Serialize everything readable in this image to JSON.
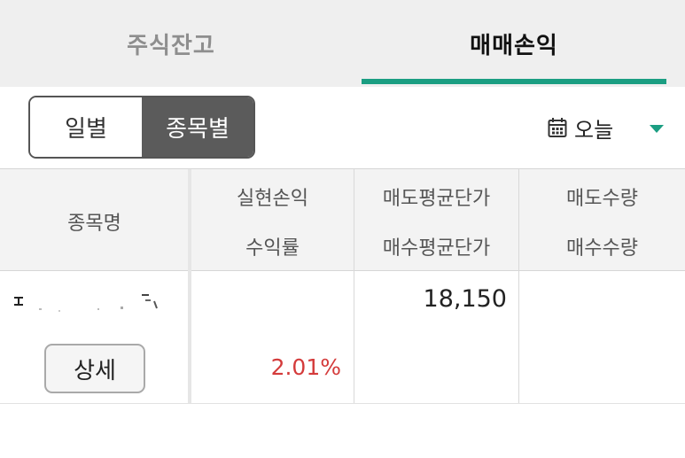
{
  "tabs": {
    "holdings_label": "주식잔고",
    "pnl_label": "매매손익",
    "active": "매매손익"
  },
  "segment": {
    "daily_label": "일별",
    "by_stock_label": "종목별",
    "selected": "종목별"
  },
  "date_filter": {
    "icon": "calendar-icon",
    "label": "오늘",
    "dropdown_icon": "caret-down-icon"
  },
  "table": {
    "headers": {
      "name": "종목명",
      "realized_pnl": "실현손익",
      "return_rate": "수익률",
      "avg_sell_price": "매도평균단가",
      "avg_buy_price": "매수평균단가",
      "sell_qty": "매도수량",
      "buy_qty": "매수수량"
    },
    "rows": [
      {
        "name_obscured": true,
        "detail_label": "상세",
        "realized_pnl": "",
        "return_rate": "2.01%",
        "avg_sell_price": "",
        "avg_buy_price": "18,150",
        "sell_qty": "",
        "buy_qty": ""
      }
    ]
  },
  "colors": {
    "accent": "#1b9e82",
    "positive": "#d43b3b",
    "segment_active": "#5b5b5b"
  }
}
